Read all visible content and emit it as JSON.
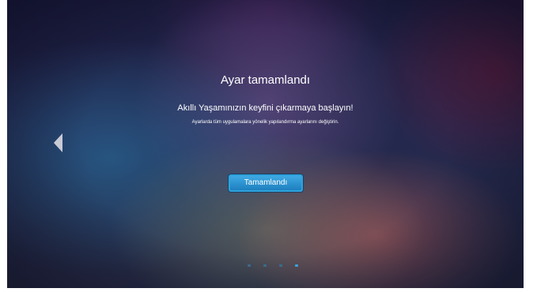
{
  "page": {
    "title": "Ayar tamamlandı",
    "subtitle": "Akıllı Yaşamınızın keyfini çıkarmaya başlayın!",
    "description": "Ayarlarda tüm uygulamalara yönelik yapılandırma ayarlarını değiştirin.",
    "done_button_label": "Tamamlandı"
  },
  "navigation": {
    "back_icon": "chevron-left-icon"
  },
  "pager": {
    "total": 4,
    "current": 4
  },
  "colors": {
    "accent": "#2fa3dc",
    "text": "#ffffff",
    "inactive_dot": "#3a6b8e",
    "active_dot": "#3aa2e0"
  }
}
